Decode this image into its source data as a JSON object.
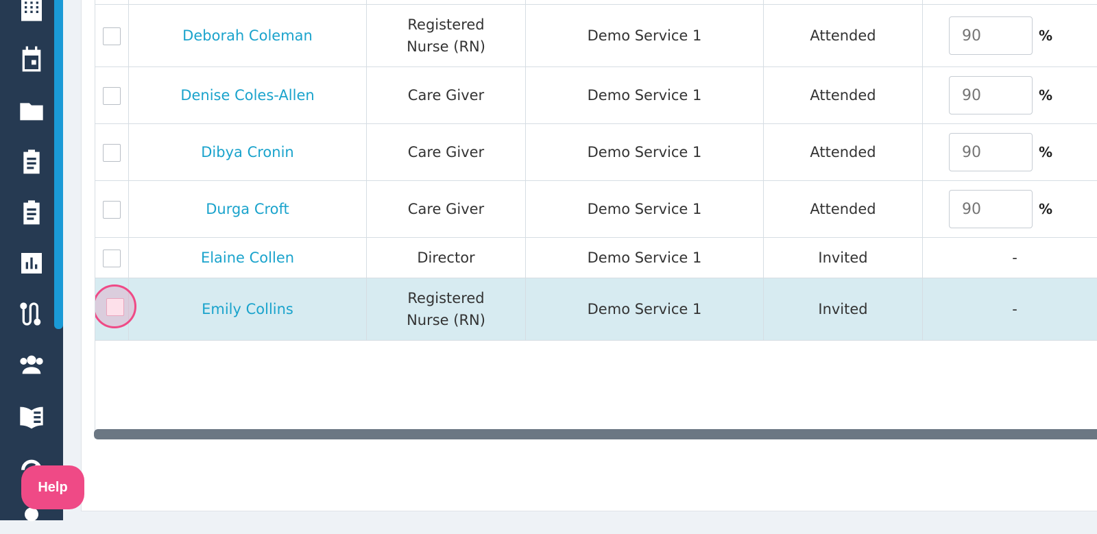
{
  "sidebar": {
    "icons": [
      "building-icon",
      "calendar-icon",
      "folder-icon",
      "clipboard-icon",
      "clipboard-list-icon",
      "chart-icon",
      "route-icon",
      "users-icon",
      "book-icon",
      "gauge-icon",
      "user-icon"
    ]
  },
  "table": {
    "rows": [
      {
        "name": "Deborah Coleman",
        "role": "Registered Nurse (RN)",
        "service": "Demo Service 1",
        "status": "Attended",
        "score": "90",
        "unit": "%"
      },
      {
        "name": "Denise Coles-Allen",
        "role": "Care Giver",
        "service": "Demo Service 1",
        "status": "Attended",
        "score": "90",
        "unit": "%"
      },
      {
        "name": "Dibya Cronin",
        "role": "Care Giver",
        "service": "Demo Service 1",
        "status": "Attended",
        "score": "90",
        "unit": "%"
      },
      {
        "name": "Durga Croft",
        "role": "Care Giver",
        "service": "Demo Service 1",
        "status": "Attended",
        "score": "90",
        "unit": "%"
      },
      {
        "name": "Elaine Collen",
        "role": "Director",
        "service": "Demo Service 1",
        "status": "Invited",
        "score_text": "-"
      },
      {
        "name": "Emily Collins",
        "role": "Registered Nurse (RN)",
        "service": "Demo Service 1",
        "status": "Invited",
        "score_text": "-"
      }
    ]
  },
  "help_label": "Help",
  "colors": {
    "sidebar": "#263a52",
    "accent": "#1a9ad6",
    "link": "#1aa3cc",
    "help": "#ef4a86",
    "selected_row": "#d7ebf1"
  }
}
